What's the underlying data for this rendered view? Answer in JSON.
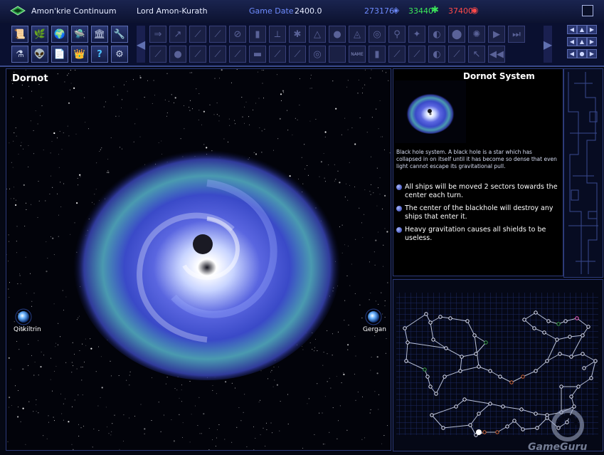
{
  "topbar": {
    "empire_name": "Amon'krie Continuum",
    "leader_name": "Lord Amon-Kurath",
    "game_date_label": "Game Date",
    "game_date_value": "2400.0",
    "resource_blue": "273176",
    "resource_green": "33440",
    "resource_red": "37400"
  },
  "toolbar": {
    "left_buttons": [
      "📜",
      "🌿",
      "🌍",
      "🛸",
      "🏛",
      "🔧",
      "⚗",
      "👽",
      "📄",
      "👑",
      "?",
      "⚙"
    ],
    "name_label": "NAME"
  },
  "main": {
    "sector_title": "Dornot",
    "planets": [
      {
        "name": "Qitkiltrin"
      },
      {
        "name": "Gergan"
      }
    ]
  },
  "info": {
    "system_title": "Dornot System",
    "description": "Black hole system. A black hole is a star which has collapsed in on itself until it has become so dense that even light cannot escape its gravitational pull.",
    "bullets": [
      "All ships will be moved 2 sectors towards the center each turn.",
      "The center of the blackhole will destroy any ships that enter it.",
      "Heavy gravitation causes all shields to be useless."
    ]
  },
  "watermark": "GameGuru",
  "colors": {
    "accent_blue": "#6f8cff",
    "accent_green": "#3ce85a",
    "accent_red": "#ff4a4a",
    "frame": "#3a4a8a"
  }
}
